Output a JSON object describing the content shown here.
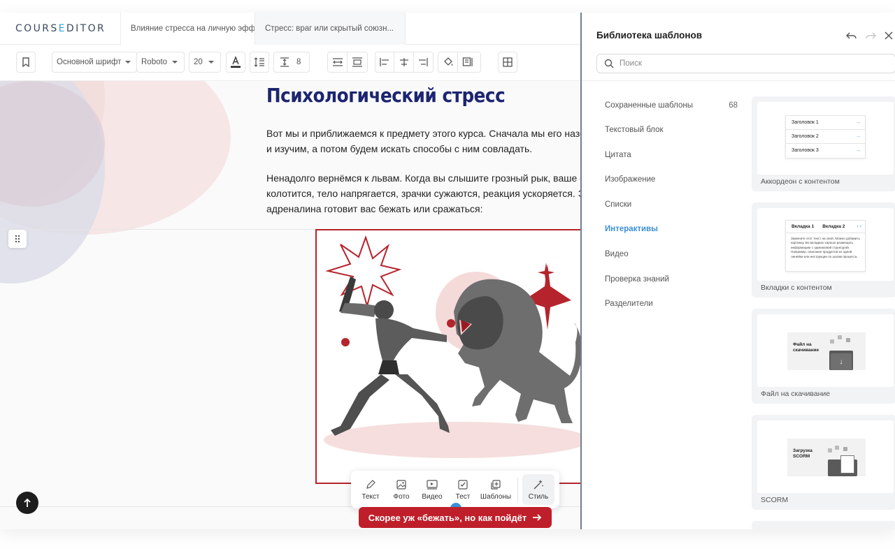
{
  "app": {
    "logo_main": "COURS",
    "logo_accent": "E",
    "logo_tail": "DITOR",
    "tabs": [
      "Влияние стресса на личную эфф...",
      "Стресс: враг или скрытый союзн..."
    ]
  },
  "toolbar": {
    "font_style": "Основной шрифт",
    "font_family": "Roboto",
    "font_size": "20",
    "line_spacing": "8"
  },
  "content": {
    "heading": "Психологический стресс",
    "para1_line1": "Вот мы и приближаемся к предмету этого курса. Сначала мы его назо",
    "para1_line2": "и изучим, а потом будем искать способы с ним совладать.",
    "para2_line1": "Ненадолго вернёмся к львам. Когда вы слышите грозный рык, ваше с",
    "para2_line2": "колотится, тело напрягается, зрачки сужаются, реакция ускоряется. Э",
    "para2_line3": "адреналина готовит вас бежать или сражаться:",
    "cta": "Скорее уж «бежать», но как пойдёт"
  },
  "insert_bar": {
    "text": "Текст",
    "photo": "Фото",
    "video": "Видео",
    "test": "Тест",
    "templates": "Шаблоны",
    "style": "Стиль"
  },
  "panel": {
    "title": "Библиотека шаблонов",
    "search_placeholder": "Поиск",
    "categories": [
      {
        "label": "Сохраненные шаблоны",
        "count": "68"
      },
      {
        "label": "Текстовый блок"
      },
      {
        "label": "Цитата"
      },
      {
        "label": "Изображение"
      },
      {
        "label": "Списки"
      },
      {
        "label": "Интерактивы"
      },
      {
        "label": "Видео"
      },
      {
        "label": "Проверка знаний"
      },
      {
        "label": "Разделители"
      }
    ],
    "active_category": "Интерактивы",
    "cards": [
      {
        "label": "Аккордеон с контентом",
        "items": [
          "Заголовок 1",
          "Заголовок 2",
          "Заголовок 3"
        ]
      },
      {
        "label": "Вкладки с контентом",
        "tab1": "Вкладка 1",
        "tab2": "Вкладка 2",
        "body": "Замените этот текст на свой. Можно добавить картинку. Во вкладках хорошо размещать информацию с одинаковой структурой. Например, описание продуктов из одной линейки или инструкции по шагам процесса."
      },
      {
        "label": "Файл на скачивание",
        "caption": "Файл на скачивание"
      },
      {
        "label": "SCORM",
        "caption": "Загрузка SCORM"
      }
    ]
  },
  "colors": {
    "accent_blue": "#3b8fd6",
    "brand_red": "#bf1f2a",
    "heading_navy": "#1c2570"
  }
}
